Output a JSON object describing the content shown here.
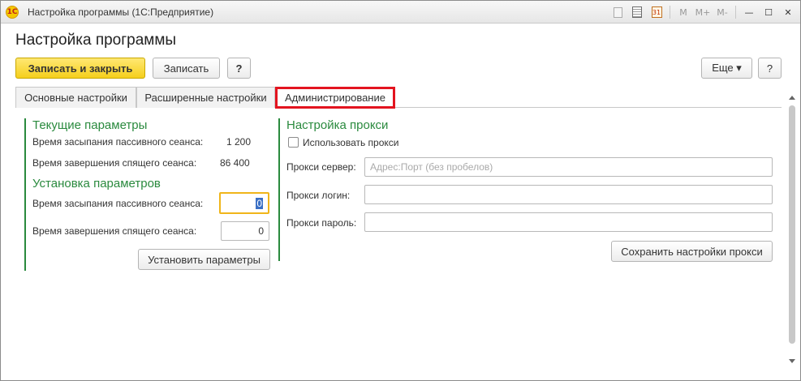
{
  "window": {
    "title": "Настройка программы  (1С:Предприятие)",
    "app_icon": "1C"
  },
  "titlebar_tools": {
    "m": "M",
    "m_plus": "M+",
    "m_minus": "M-",
    "minimize": "—",
    "maximize": "☐",
    "close": "✕"
  },
  "page": {
    "title": "Настройка программы"
  },
  "toolbar": {
    "save_close": "Записать и закрыть",
    "save": "Записать",
    "help": "?",
    "more": "Еще ▾",
    "help2": "?"
  },
  "tabs": [
    {
      "label": "Основные настройки",
      "active": false
    },
    {
      "label": "Расширенные настройки",
      "active": false
    },
    {
      "label": "Администрирование",
      "active": true
    }
  ],
  "current_params": {
    "title": "Текущие параметры",
    "idle_sleep_label": "Время засыпания пассивного сеанса:",
    "idle_sleep_value": "1 200",
    "sleep_end_label": "Время завершения спящего сеанса:",
    "sleep_end_value": "86 400"
  },
  "set_params": {
    "title": "Установка параметров",
    "idle_sleep_label": "Время засыпания пассивного сеанса:",
    "idle_sleep_value": "0",
    "sleep_end_label": "Время завершения спящего сеанса:",
    "sleep_end_value": "0",
    "apply_button": "Установить параметры"
  },
  "proxy": {
    "title": "Настройка прокси",
    "use_proxy_label": "Использовать прокси",
    "use_proxy_checked": false,
    "server_label": "Прокси сервер:",
    "server_placeholder": "Адрес:Порт (без пробелов)",
    "server_value": "",
    "login_label": "Прокси логин:",
    "login_value": "",
    "password_label": "Прокси пароль:",
    "password_value": "",
    "save_button": "Сохранить настройки прокси"
  },
  "colors": {
    "accent_green": "#2a8a3e",
    "primary_yellow": "#f5cf1c",
    "highlight_red": "#e3141f"
  }
}
